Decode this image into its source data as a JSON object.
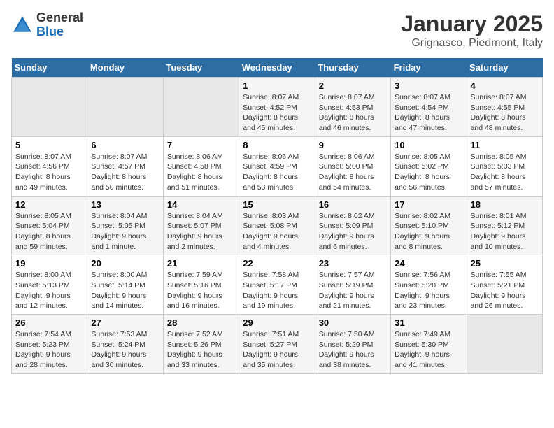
{
  "logo": {
    "general": "General",
    "blue": "Blue"
  },
  "header": {
    "title": "January 2025",
    "subtitle": "Grignasco, Piedmont, Italy"
  },
  "weekdays": [
    "Sunday",
    "Monday",
    "Tuesday",
    "Wednesday",
    "Thursday",
    "Friday",
    "Saturday"
  ],
  "weeks": [
    [
      {
        "day": "",
        "info": ""
      },
      {
        "day": "",
        "info": ""
      },
      {
        "day": "",
        "info": ""
      },
      {
        "day": "1",
        "info": "Sunrise: 8:07 AM\nSunset: 4:52 PM\nDaylight: 8 hours\nand 45 minutes."
      },
      {
        "day": "2",
        "info": "Sunrise: 8:07 AM\nSunset: 4:53 PM\nDaylight: 8 hours\nand 46 minutes."
      },
      {
        "day": "3",
        "info": "Sunrise: 8:07 AM\nSunset: 4:54 PM\nDaylight: 8 hours\nand 47 minutes."
      },
      {
        "day": "4",
        "info": "Sunrise: 8:07 AM\nSunset: 4:55 PM\nDaylight: 8 hours\nand 48 minutes."
      }
    ],
    [
      {
        "day": "5",
        "info": "Sunrise: 8:07 AM\nSunset: 4:56 PM\nDaylight: 8 hours\nand 49 minutes."
      },
      {
        "day": "6",
        "info": "Sunrise: 8:07 AM\nSunset: 4:57 PM\nDaylight: 8 hours\nand 50 minutes."
      },
      {
        "day": "7",
        "info": "Sunrise: 8:06 AM\nSunset: 4:58 PM\nDaylight: 8 hours\nand 51 minutes."
      },
      {
        "day": "8",
        "info": "Sunrise: 8:06 AM\nSunset: 4:59 PM\nDaylight: 8 hours\nand 53 minutes."
      },
      {
        "day": "9",
        "info": "Sunrise: 8:06 AM\nSunset: 5:00 PM\nDaylight: 8 hours\nand 54 minutes."
      },
      {
        "day": "10",
        "info": "Sunrise: 8:05 AM\nSunset: 5:02 PM\nDaylight: 8 hours\nand 56 minutes."
      },
      {
        "day": "11",
        "info": "Sunrise: 8:05 AM\nSunset: 5:03 PM\nDaylight: 8 hours\nand 57 minutes."
      }
    ],
    [
      {
        "day": "12",
        "info": "Sunrise: 8:05 AM\nSunset: 5:04 PM\nDaylight: 8 hours\nand 59 minutes."
      },
      {
        "day": "13",
        "info": "Sunrise: 8:04 AM\nSunset: 5:05 PM\nDaylight: 9 hours\nand 1 minute."
      },
      {
        "day": "14",
        "info": "Sunrise: 8:04 AM\nSunset: 5:07 PM\nDaylight: 9 hours\nand 2 minutes."
      },
      {
        "day": "15",
        "info": "Sunrise: 8:03 AM\nSunset: 5:08 PM\nDaylight: 9 hours\nand 4 minutes."
      },
      {
        "day": "16",
        "info": "Sunrise: 8:02 AM\nSunset: 5:09 PM\nDaylight: 9 hours\nand 6 minutes."
      },
      {
        "day": "17",
        "info": "Sunrise: 8:02 AM\nSunset: 5:10 PM\nDaylight: 9 hours\nand 8 minutes."
      },
      {
        "day": "18",
        "info": "Sunrise: 8:01 AM\nSunset: 5:12 PM\nDaylight: 9 hours\nand 10 minutes."
      }
    ],
    [
      {
        "day": "19",
        "info": "Sunrise: 8:00 AM\nSunset: 5:13 PM\nDaylight: 9 hours\nand 12 minutes."
      },
      {
        "day": "20",
        "info": "Sunrise: 8:00 AM\nSunset: 5:14 PM\nDaylight: 9 hours\nand 14 minutes."
      },
      {
        "day": "21",
        "info": "Sunrise: 7:59 AM\nSunset: 5:16 PM\nDaylight: 9 hours\nand 16 minutes."
      },
      {
        "day": "22",
        "info": "Sunrise: 7:58 AM\nSunset: 5:17 PM\nDaylight: 9 hours\nand 19 minutes."
      },
      {
        "day": "23",
        "info": "Sunrise: 7:57 AM\nSunset: 5:19 PM\nDaylight: 9 hours\nand 21 minutes."
      },
      {
        "day": "24",
        "info": "Sunrise: 7:56 AM\nSunset: 5:20 PM\nDaylight: 9 hours\nand 23 minutes."
      },
      {
        "day": "25",
        "info": "Sunrise: 7:55 AM\nSunset: 5:21 PM\nDaylight: 9 hours\nand 26 minutes."
      }
    ],
    [
      {
        "day": "26",
        "info": "Sunrise: 7:54 AM\nSunset: 5:23 PM\nDaylight: 9 hours\nand 28 minutes."
      },
      {
        "day": "27",
        "info": "Sunrise: 7:53 AM\nSunset: 5:24 PM\nDaylight: 9 hours\nand 30 minutes."
      },
      {
        "day": "28",
        "info": "Sunrise: 7:52 AM\nSunset: 5:26 PM\nDaylight: 9 hours\nand 33 minutes."
      },
      {
        "day": "29",
        "info": "Sunrise: 7:51 AM\nSunset: 5:27 PM\nDaylight: 9 hours\nand 35 minutes."
      },
      {
        "day": "30",
        "info": "Sunrise: 7:50 AM\nSunset: 5:29 PM\nDaylight: 9 hours\nand 38 minutes."
      },
      {
        "day": "31",
        "info": "Sunrise: 7:49 AM\nSunset: 5:30 PM\nDaylight: 9 hours\nand 41 minutes."
      },
      {
        "day": "",
        "info": ""
      }
    ]
  ]
}
